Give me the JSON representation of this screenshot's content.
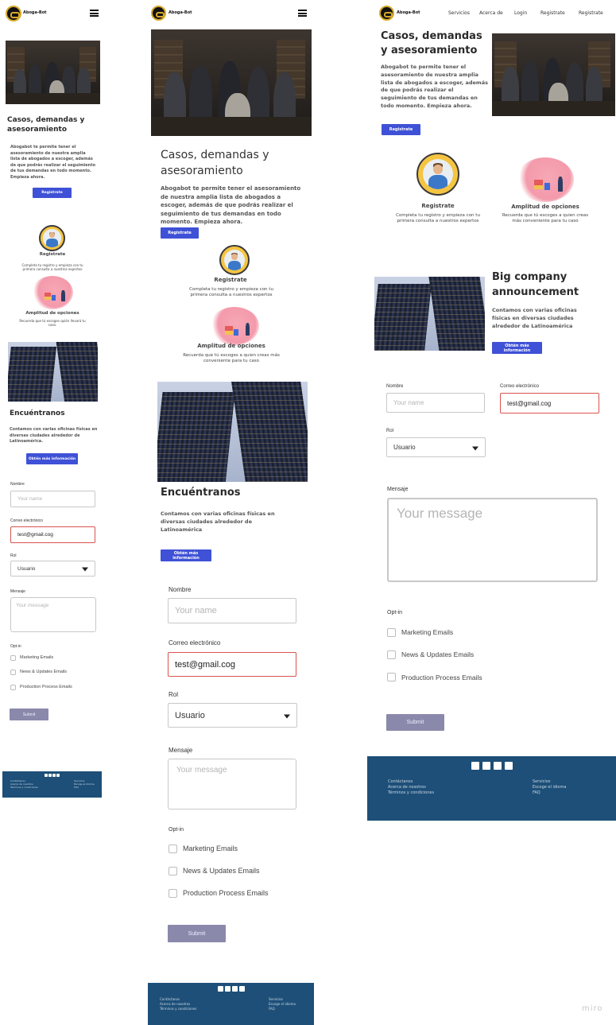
{
  "brand": {
    "name": "Aboga-Bot"
  },
  "nav": {
    "servicios": "Servicios",
    "acerca": "Acerca de",
    "login": "Login",
    "registrate": "Registrate"
  },
  "hero": {
    "title": "Casos, demandas y asesoramiento",
    "text": "Abogabot te permite tener el asesoramiento de nuestra amplia lista de abogados a escoger, además de que podrás realizar el seguimiento de tus demandas en todo momento. Empieza ahora.",
    "button": "Registrate"
  },
  "features": {
    "register_title": "Registrate",
    "register_text": "Completa tu registro y empieza con tu primera consulta a nuestros expertos",
    "options_title": "Amplitud de opciones",
    "options_text": "Recuerda que tú escoges a quien creas más conveniente para tu caso",
    "options_text_small": "Recuerda que tú escoges quién llevará tu caso."
  },
  "find": {
    "title": "Encuéntranos",
    "title_desktop": "Big company announcement",
    "text": "Contamos con varias oficinas físicas en diversas ciudades alrededor de Latinoamérica",
    "text_small": "Contamos con varias oficinas físicas en diversas ciudades alrededor de Latinoamérica.",
    "button": "Obtén más información"
  },
  "form": {
    "name_label": "Nombre",
    "name_placeholder": "Your name",
    "email_label": "Correo electrónico",
    "email_value": "test@gmail.cog",
    "role_label": "Rol",
    "role_value": "Usuario",
    "message_label": "Mensaje",
    "message_placeholder": "Your message",
    "optin_label": "Opt-in",
    "opt1": "Marketing Emails",
    "opt2": "News & Updates Emails",
    "opt3": "Production Process Emails",
    "submit": "Submit"
  },
  "footer": {
    "contact": "Contáctanos",
    "about": "Acerca de nosotros",
    "terms": "Términos y condiciones",
    "services": "Servicios",
    "language": "Escoge el idioma",
    "faq": "FAQ",
    "icons": [
      "twitter-icon",
      "facebook-icon",
      "google-plus-icon",
      "instagram-icon"
    ]
  },
  "watermark": "miro",
  "colors": {
    "primary": "#3f51d6",
    "footer": "#1d4f78",
    "submit": "#8a89ab",
    "error": "#d9534f"
  }
}
